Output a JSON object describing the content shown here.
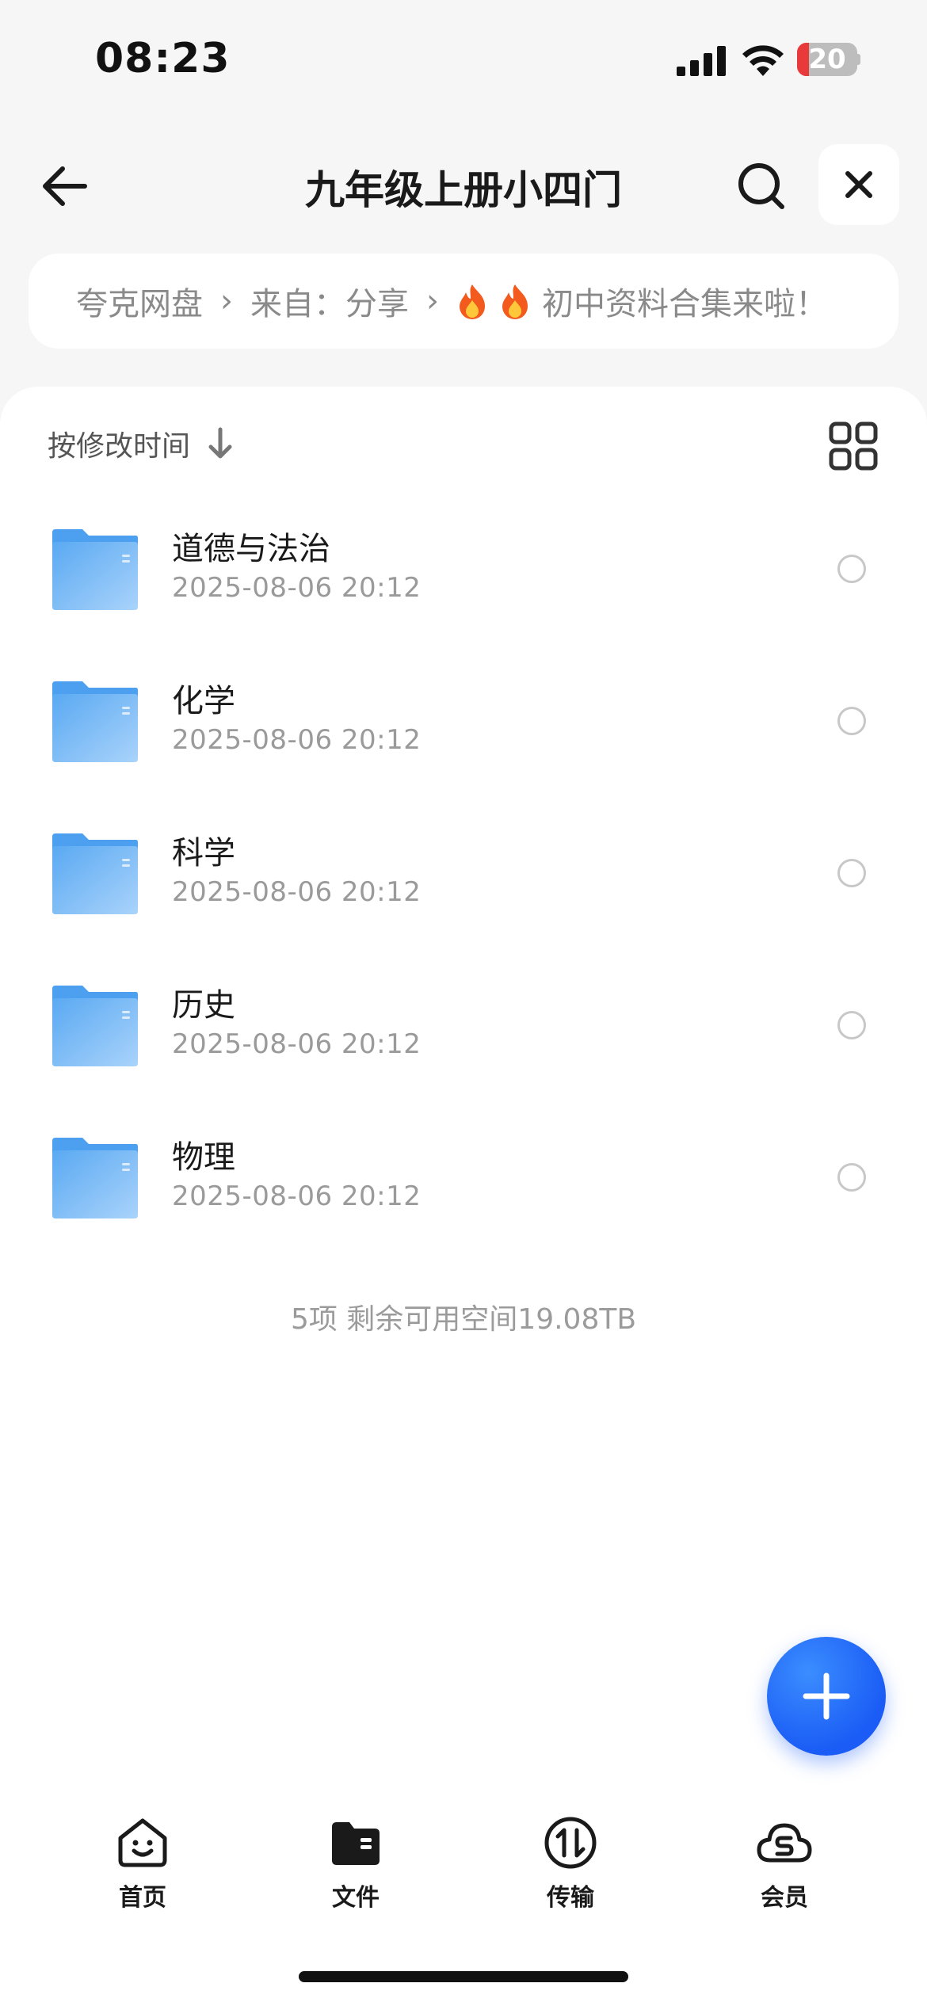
{
  "status_bar": {
    "time": "08:23",
    "battery_level": "20",
    "battery_fraction": 0.2,
    "battery_color": "#e8393b"
  },
  "header": {
    "title": "九年级上册小四门",
    "back_icon": "arrow-left-icon",
    "search_icon": "search-icon",
    "close_icon": "close-icon"
  },
  "breadcrumb": {
    "items": [
      "夸克网盘",
      "来自：分享"
    ],
    "current": "初中资料合集来啦！",
    "separator": "›",
    "emoji_icon": "fire-icon"
  },
  "toolbar": {
    "sort_label": "按修改时间",
    "sort_icon": "arrow-down-icon",
    "view_icon": "grid-view-icon"
  },
  "files": [
    {
      "name": "道德与法治",
      "date": "2025-08-06 20:12"
    },
    {
      "name": "化学",
      "date": "2025-08-06 20:12"
    },
    {
      "name": "科学",
      "date": "2025-08-06 20:12"
    },
    {
      "name": "历史",
      "date": "2025-08-06 20:12"
    },
    {
      "name": "物理",
      "date": "2025-08-06 20:12"
    }
  ],
  "footer_info": "5项 剩余可用空间19.08TB",
  "fab_icon": "plus-icon",
  "tabs": [
    {
      "label": "首页",
      "icon": "home-smile-icon"
    },
    {
      "label": "文件",
      "icon": "folder-icon"
    },
    {
      "label": "传输",
      "icon": "transfer-icon"
    },
    {
      "label": "会员",
      "icon": "cloud-member-icon"
    }
  ],
  "colors": {
    "accent": "#1a5cf5",
    "folder": "#5aa9f2",
    "background": "#f6f6f6"
  }
}
